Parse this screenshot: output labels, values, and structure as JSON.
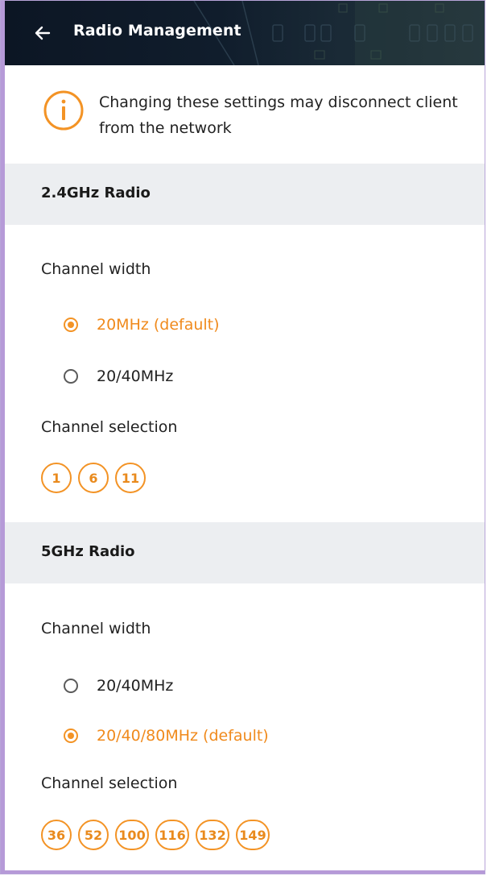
{
  "header": {
    "title": "Radio Management",
    "back_icon": "arrow-left-icon"
  },
  "notice": {
    "icon": "info-circle-icon",
    "message": "Changing these settings may disconnect client from the network"
  },
  "colors": {
    "accent": "#f39325",
    "section_bg": "#eceef1",
    "header_bg": "#0c1624"
  },
  "radio24": {
    "title": "2.4GHz Radio",
    "channel_width_label": "Channel width",
    "options": [
      {
        "label": "20MHz (default)",
        "checked": true
      },
      {
        "label": "20/40MHz",
        "checked": false
      }
    ],
    "channel_selection_label": "Channel selection",
    "channels": [
      "1",
      "6",
      "11"
    ]
  },
  "radio5": {
    "title": "5GHz Radio",
    "channel_width_label": "Channel width",
    "options": [
      {
        "label": "20/40MHz",
        "checked": false
      },
      {
        "label": "20/40/80MHz (default)",
        "checked": true
      }
    ],
    "channel_selection_label": "Channel selection",
    "channels": [
      "36",
      "52",
      "100",
      "116",
      "132",
      "149"
    ]
  }
}
